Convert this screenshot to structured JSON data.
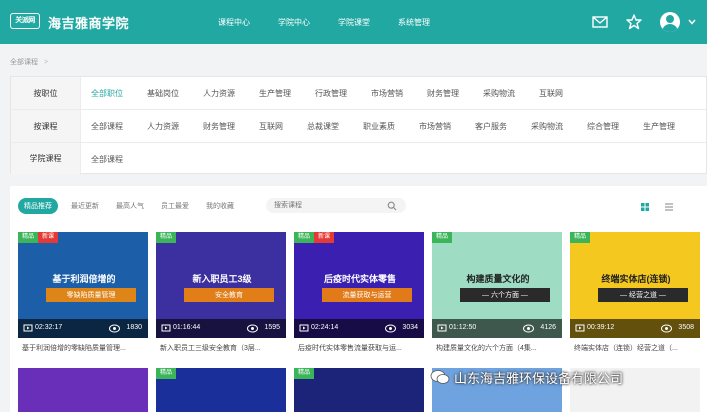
{
  "header": {
    "logo_text": "关派网",
    "brand": "海吉雅商学院",
    "nav": [
      "课程中心",
      "学院中心",
      "学院课堂",
      "系统管理"
    ],
    "icons": [
      "mail-icon",
      "star-icon",
      "user-avatar-icon",
      "chevron-down-icon"
    ]
  },
  "breadcrumb": {
    "current": "全部课程",
    "separator": ">"
  },
  "filters": [
    {
      "label": "按职位",
      "options": [
        "全部职位",
        "基础岗位",
        "人力资源",
        "生产管理",
        "行政管理",
        "市场营销",
        "财务管理",
        "采购物流",
        "互联网"
      ],
      "active": 0
    },
    {
      "label": "按课程",
      "options": [
        "全部课程",
        "人力资源",
        "财务管理",
        "互联网",
        "总裁课堂",
        "职业素质",
        "市场营销",
        "客户服务",
        "采购物流",
        "综合管理",
        "生产管理"
      ],
      "active": -1
    },
    {
      "label": "学院课程",
      "options": [
        "全部课程"
      ],
      "active": -1
    }
  ],
  "sortbar": {
    "tabs": [
      "精品推荐",
      "最近更新",
      "最高人气",
      "员工最爱",
      "我的收藏"
    ],
    "active": 0,
    "search_placeholder": "搜索课程"
  },
  "cards": [
    {
      "tags": [
        "精品",
        "新课"
      ],
      "thumb_title": "基于利润倍增的",
      "thumb_sub": "零缺陷质量管理",
      "duration": "02:32:17",
      "views": "1830",
      "title": "基于利润倍增的零缺陷质量管理...",
      "bg": "#1c5fa8"
    },
    {
      "tags": [
        "精品"
      ],
      "thumb_title": "新入职员工3级",
      "thumb_sub": "安全教育",
      "duration": "01:16:44",
      "views": "1595",
      "title": "新入职员工三级安全教育（3层...",
      "bg": "#3c2fa0"
    },
    {
      "tags": [
        "精品",
        "新课"
      ],
      "thumb_title": "后疫时代实体零售",
      "thumb_sub": "流量获取与运营",
      "duration": "02:24:14",
      "views": "3034",
      "title": "后疫时代实体零售流量获取与运...",
      "bg": "#3a1fb0"
    },
    {
      "tags": [
        "精品"
      ],
      "thumb_title": "构建质量文化的",
      "thumb_sub": "— 六个方面 —",
      "duration": "01:12:50",
      "views": "4126",
      "title": "构建质量文化的六个方面（4集...",
      "bg": "#9fdcc4"
    },
    {
      "tags": [
        "精品"
      ],
      "thumb_title": "终端实体店(连锁)",
      "thumb_sub": "— 经营之道 —",
      "duration": "00:39:12",
      "views": "3508",
      "title": "终端实体店（连锁）经营之道（...",
      "bg": "#f4c81e"
    }
  ],
  "row2": [
    {
      "tags": [],
      "bg": "#6a2fb8"
    },
    {
      "tags": [
        "精品"
      ],
      "bg": "#1a2f9a"
    },
    {
      "tags": [
        "精品"
      ],
      "bg": "#1b2478"
    },
    {
      "tags": [],
      "bg": "#6fa3e0"
    },
    {
      "tags": [],
      "bg": "#f2f2f2"
    }
  ],
  "watermark": "山东海吉雅环保设备有限公司",
  "colors": {
    "accent": "#22a8a2",
    "tag_green": "#3cb55a",
    "tag_red": "#e53935"
  }
}
